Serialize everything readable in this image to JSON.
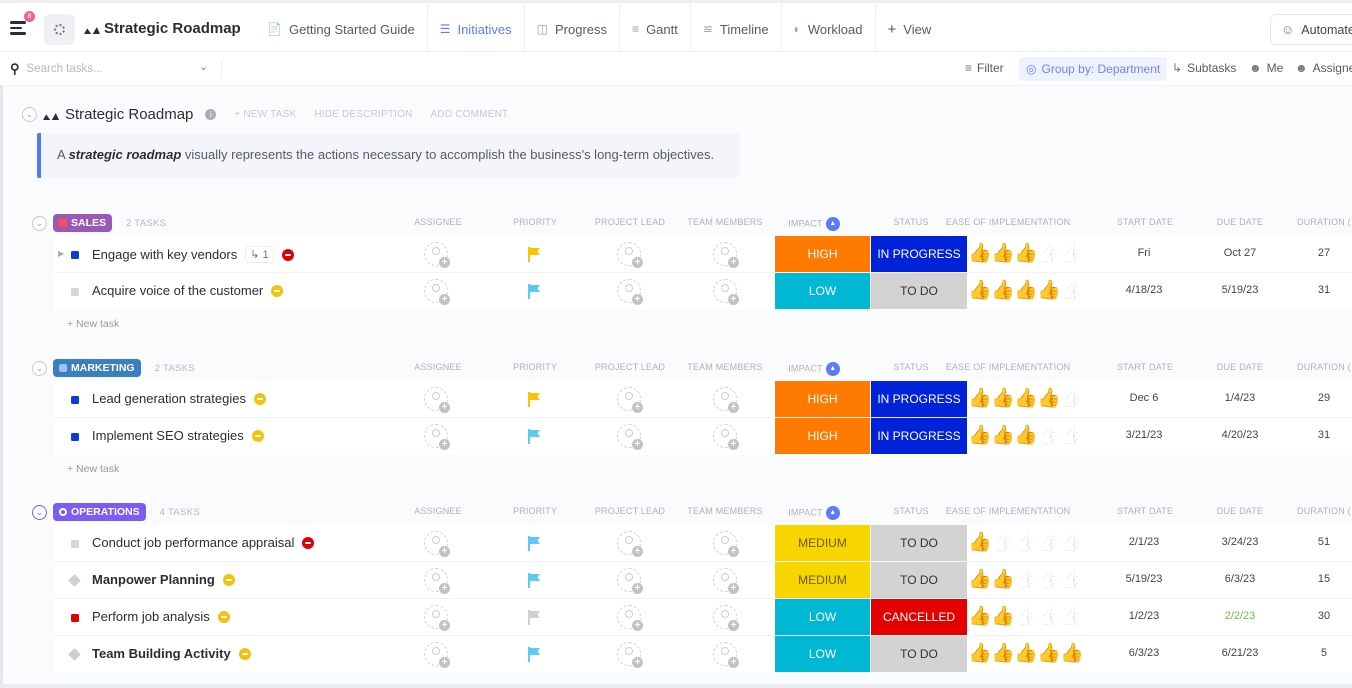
{
  "topbar": {
    "notification_count": "8",
    "project_title": "Strategic Roadmap",
    "tabs": [
      {
        "label": "Getting Started Guide",
        "icon": "doc-icon"
      },
      {
        "label": "Initiatives",
        "icon": "list-icon",
        "active": true
      },
      {
        "label": "Progress",
        "icon": "board-icon"
      },
      {
        "label": "Gantt",
        "icon": "gantt-icon"
      },
      {
        "label": "Timeline",
        "icon": "timeline-icon"
      },
      {
        "label": "Workload",
        "icon": "gauge-icon"
      },
      {
        "label": "View",
        "icon": "plus-icon"
      }
    ],
    "automate_label": "Automate"
  },
  "toolbar": {
    "search_placeholder": "Search tasks...",
    "filter_label": "Filter",
    "groupby_label": "Group by: Department",
    "subtasks_label": "Subtasks",
    "me_label": "Me",
    "assignees_label": "Assignees"
  },
  "list": {
    "title": "Strategic Roadmap",
    "new_task_label": "+ NEW TASK",
    "hide_description_label": "HIDE DESCRIPTION",
    "add_comment_label": "ADD COMMENT",
    "description_prefix": "A ",
    "description_bold": "strategic roadmap",
    "description_rest": " visually represents the actions necessary to accomplish the business's long-term objectives."
  },
  "columns": {
    "assignee": "ASSIGNEE",
    "priority": "PRIORITY",
    "project_lead": "PROJECT LEAD",
    "team_members": "TEAM MEMBERS",
    "impact": "IMPACT",
    "status": "STATUS",
    "ease": "EASE OF IMPLEMENTATION",
    "start_date": "START DATE",
    "due_date": "DUE DATE",
    "duration": "DURATION ("
  },
  "new_task_row_label": "+ New task",
  "colors": {
    "accent": "#5b7bfa",
    "impact_high": "#ff7a00",
    "impact_low": "#00b8d4",
    "impact_medium": "#f7d600",
    "status_in_progress": "#0022d9",
    "status_todo": "#d3d3d3",
    "status_cancelled": "#e50000"
  },
  "groups": [
    {
      "name": "SALES",
      "color": "#9b59b6",
      "count_label": "2 TASKS",
      "tasks": [
        {
          "name": "Engage with key vendors",
          "bold": false,
          "marker_color": "#0b3bd9",
          "marker_shape": "square",
          "subtasks": "1",
          "has_expander": true,
          "blocker_color": "#e00000",
          "priority_color": "#fbc400",
          "impact": "HIGH",
          "impact_key": "high",
          "status": "IN PROGRESS",
          "status_key": "in_progress",
          "ease": 3,
          "start": "Fri",
          "due": "Oct 27",
          "due_color": "#444",
          "duration": "27"
        },
        {
          "name": "Acquire voice of the customer",
          "bold": false,
          "marker_color": "#d6d6d6",
          "marker_shape": "square",
          "subtasks": null,
          "has_expander": false,
          "blocker_color": "#f4c20d",
          "priority_color": "#5cc8f5",
          "impact": "LOW",
          "impact_key": "low",
          "status": "TO DO",
          "status_key": "todo",
          "ease": 4,
          "start": "4/18/23",
          "due": "5/19/23",
          "due_color": "#444",
          "duration": "31"
        }
      ]
    },
    {
      "name": "MARKETING",
      "color": "#3a7fc1",
      "count_label": "2 TASKS",
      "tasks": [
        {
          "name": "Lead generation strategies",
          "bold": false,
          "marker_color": "#0b3bd9",
          "marker_shape": "square",
          "subtasks": null,
          "has_expander": false,
          "blocker_color": "#f4c20d",
          "priority_color": "#fbc400",
          "impact": "HIGH",
          "impact_key": "high",
          "status": "IN PROGRESS",
          "status_key": "in_progress",
          "ease": 4,
          "start": "Dec 6",
          "due": "1/4/23",
          "due_color": "#444",
          "duration": "29"
        },
        {
          "name": "Implement SEO strategies",
          "bold": false,
          "marker_color": "#0b3bd9",
          "marker_shape": "square",
          "subtasks": null,
          "has_expander": false,
          "blocker_color": "#f4c20d",
          "priority_color": "#5cc8f5",
          "impact": "HIGH",
          "impact_key": "high",
          "status": "IN PROGRESS",
          "status_key": "in_progress",
          "ease": 3,
          "start": "3/21/23",
          "due": "4/20/23",
          "due_color": "#444",
          "duration": "31"
        }
      ]
    },
    {
      "name": "OPERATIONS",
      "color": "#7b5cf5",
      "count_label": "4 TASKS",
      "tasks": [
        {
          "name": "Conduct job performance appraisal",
          "bold": false,
          "marker_color": "#d6d6d6",
          "marker_shape": "square",
          "subtasks": null,
          "has_expander": false,
          "blocker_color": "#e00000",
          "priority_color": "#5cc8f5",
          "impact": "MEDIUM",
          "impact_key": "medium",
          "status": "TO DO",
          "status_key": "todo",
          "ease": 1,
          "start": "2/1/23",
          "due": "3/24/23",
          "due_color": "#444",
          "duration": "51"
        },
        {
          "name": "Manpower Planning",
          "bold": true,
          "marker_color": "#cfcfcf",
          "marker_shape": "diamond",
          "subtasks": null,
          "has_expander": false,
          "blocker_color": "#f4c20d",
          "priority_color": "#5cc8f5",
          "impact": "MEDIUM",
          "impact_key": "medium",
          "status": "TO DO",
          "status_key": "todo",
          "ease": 2,
          "start": "5/19/23",
          "due": "6/3/23",
          "due_color": "#444",
          "duration": "15"
        },
        {
          "name": "Perform job analysis",
          "bold": false,
          "marker_color": "#e00000",
          "marker_shape": "square",
          "subtasks": null,
          "has_expander": false,
          "blocker_color": "#f4c20d",
          "priority_color": "#d0d0d0",
          "impact": "LOW",
          "impact_key": "low",
          "status": "CANCELLED",
          "status_key": "cancelled",
          "ease": 2,
          "start": "1/2/23",
          "due": "2/2/23",
          "due_color": "#6cc04a",
          "duration": "30"
        },
        {
          "name": "Team Building Activity",
          "bold": true,
          "marker_color": "#cfcfcf",
          "marker_shape": "diamond",
          "subtasks": null,
          "has_expander": false,
          "blocker_color": "#f4c20d",
          "priority_color": "#5cc8f5",
          "impact": "LOW",
          "impact_key": "low",
          "status": "TO DO",
          "status_key": "todo",
          "ease": 5,
          "start": "6/3/23",
          "due": "6/21/23",
          "due_color": "#444",
          "duration": "5"
        }
      ]
    }
  ]
}
